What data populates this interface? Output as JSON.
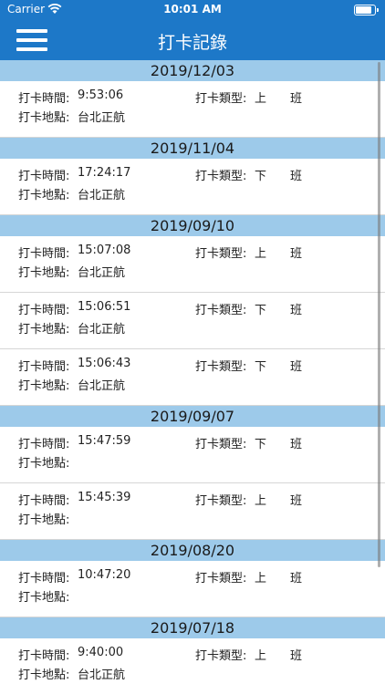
{
  "status_bar": {
    "carrier": "Carrier",
    "time": "10:01 AM",
    "battery": 0.85
  },
  "nav": {
    "title": "打卡記錄"
  },
  "labels": {
    "time": "打卡時間:",
    "location": "打卡地點:",
    "type": "打卡類型:"
  },
  "groups": [
    {
      "date": "2019/12/03",
      "records": [
        {
          "time": "9:53:06",
          "type": [
            "上",
            "班"
          ],
          "location": "台北正航"
        }
      ]
    },
    {
      "date": "2019/11/04",
      "records": [
        {
          "time": "17:24:17",
          "type": [
            "下",
            "班"
          ],
          "location": "台北正航"
        }
      ]
    },
    {
      "date": "2019/09/10",
      "records": [
        {
          "time": "15:07:08",
          "type": [
            "上",
            "班"
          ],
          "location": "台北正航"
        },
        {
          "time": "15:06:51",
          "type": [
            "下",
            "班"
          ],
          "location": "台北正航"
        },
        {
          "time": "15:06:43",
          "type": [
            "下",
            "班"
          ],
          "location": "台北正航"
        }
      ]
    },
    {
      "date": "2019/09/07",
      "records": [
        {
          "time": "15:47:59",
          "type": [
            "下",
            "班"
          ],
          "location": ""
        },
        {
          "time": "15:45:39",
          "type": [
            "上",
            "班"
          ],
          "location": ""
        }
      ]
    },
    {
      "date": "2019/08/20",
      "records": [
        {
          "time": "10:47:20",
          "type": [
            "上",
            "班"
          ],
          "location": ""
        }
      ]
    },
    {
      "date": "2019/07/18",
      "records": [
        {
          "time": "9:40:00",
          "type": [
            "上",
            "班"
          ],
          "location": "台北正航"
        }
      ]
    }
  ]
}
